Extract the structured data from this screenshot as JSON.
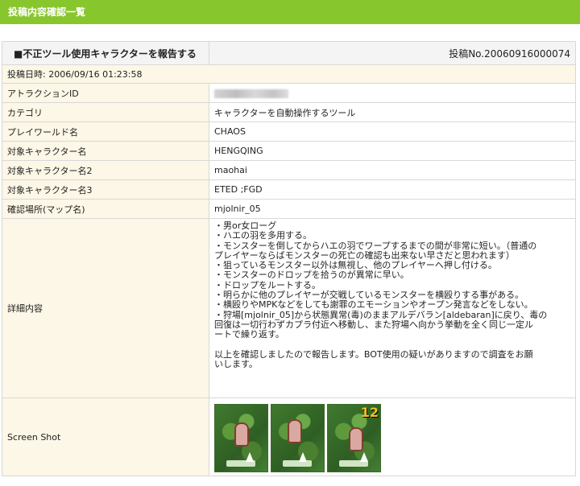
{
  "header": {
    "title": "投稿内容確認一覧"
  },
  "report": {
    "title": "■不正ツール使用キャラクターを報告する",
    "post_no": "投稿No.20060916000074",
    "posted_at": "投稿日時: 2006/09/16 01:23:58"
  },
  "fields": [
    {
      "label": "アトラクションID",
      "value": ""
    },
    {
      "label": "カテゴリ",
      "value": "キャラクターを自動操作するツール"
    },
    {
      "label": "プレイワールド名",
      "value": "CHAOS"
    },
    {
      "label": "対象キャラクター名",
      "value": "HENGQING"
    },
    {
      "label": "対象キャラクター名2",
      "value": "maohai"
    },
    {
      "label": "対象キャラクター名3",
      "value": "ETED ;FGD"
    },
    {
      "label": "確認場所(マップ名)",
      "value": "mjolnir_05"
    }
  ],
  "details": {
    "label": "詳細内容",
    "lines": [
      "・男or女ローグ",
      "・ハエの羽を多用する。",
      "・モンスターを倒してからハエの羽でワープするまでの間が非常に短い。（普通の",
      "プレイヤーならばモンスターの死亡の確認も出来ない早さだと思われます）",
      "・狙っているモンスター以外は無視し、他のプレイヤーへ押し付ける。",
      "・モンスターのドロップを拾うのが異常に早い。",
      "・ドロップをルートする。",
      "・明らかに他のプレイヤーが交戦しているモンスターを横殴りする事がある。",
      "・横殴りやMPKなどをしても謝罪のエモーションやオープン発言などをしない。",
      "・狩場[mjolnir_05]から状態異常(毒)のままアルデバラン[aldebaran]に戻り、毒の",
      "回復は一切行わずカプラ付近へ移動し、また狩場へ向かう挙動を全く同じ一定ル",
      "ートで繰り返す。",
      "",
      "以上を確認しましたので報告します。BOT使用の疑いがありますので調査をお願",
      "いします。"
    ]
  },
  "screenshots": {
    "label": "Screen Shot",
    "overlay_number": "12"
  }
}
